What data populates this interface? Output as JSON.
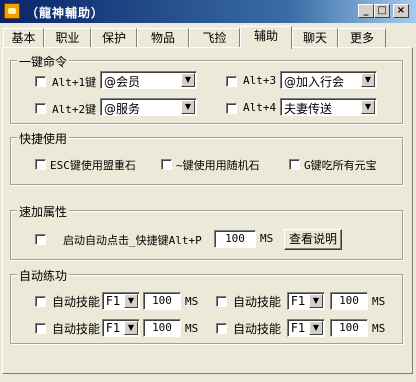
{
  "window": {
    "title": "（龍神輔助）",
    "min_glyph": "_",
    "max_glyph": "□",
    "close_glyph": "×"
  },
  "tabs": [
    "基本",
    "职业",
    "保护",
    "物品",
    "飞捡",
    "辅助",
    "聊天",
    "更多"
  ],
  "active_tab": "辅助",
  "hotkey_commands": {
    "title": "一键命令",
    "rows": [
      {
        "key": "Alt+1键",
        "value": "@会员"
      },
      {
        "key": "Alt+3",
        "value": "@加入行会"
      },
      {
        "key": "Alt+2键",
        "value": "@服务"
      },
      {
        "key": "Alt+4",
        "value": "夫妻传送"
      }
    ]
  },
  "quick_use": {
    "title": "快捷使用",
    "items": [
      "ESC键使用盟重石",
      "~键使用用随机石",
      "G键吃所有元宝"
    ]
  },
  "speed": {
    "title": "速加属性",
    "label": "启动自动点击_快捷键Alt+P",
    "value": "100",
    "unit": "MS",
    "help_button": "查看说明"
  },
  "auto_skill": {
    "title": "自动练功",
    "rows": [
      {
        "label": "自动技能",
        "key": "F1",
        "value": "100",
        "unit": "MS"
      },
      {
        "label": "自动技能",
        "key": "F1",
        "value": "100",
        "unit": "MS"
      },
      {
        "label": "自动技能",
        "key": "F1",
        "value": "100",
        "unit": "MS"
      },
      {
        "label": "自动技能",
        "key": "F1",
        "value": "100",
        "unit": "MS"
      }
    ]
  }
}
